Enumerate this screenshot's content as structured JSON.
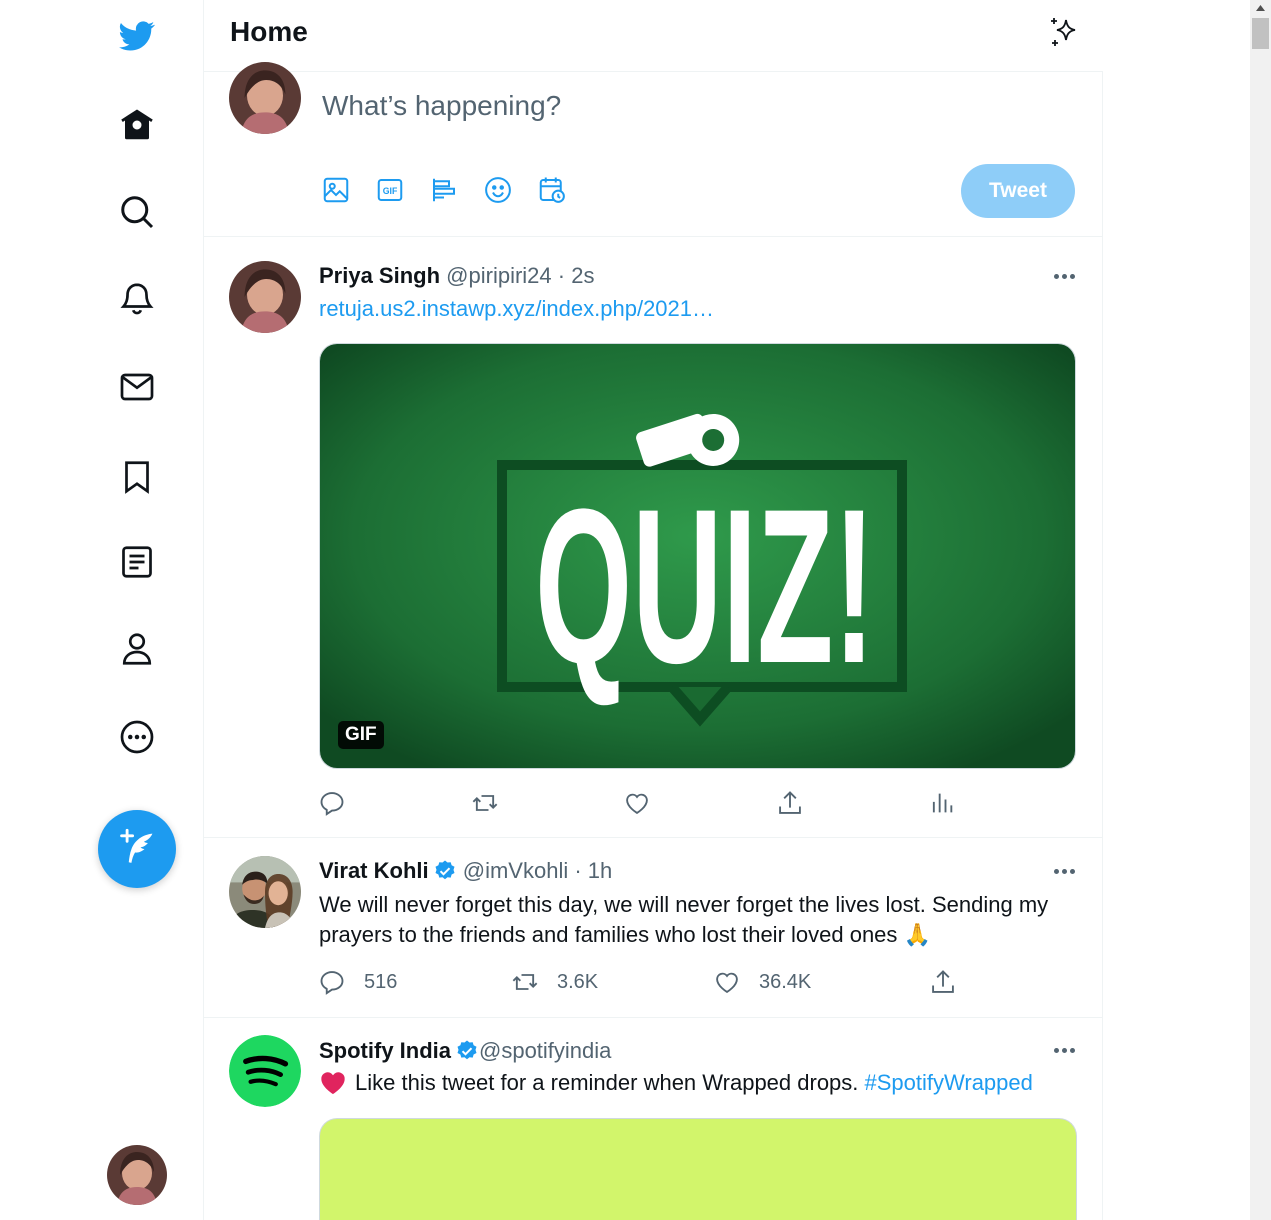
{
  "header": {
    "title": "Home"
  },
  "composer": {
    "placeholder": "What’s happening?",
    "tweet_label": "Tweet"
  },
  "tweets": [
    {
      "name": "Priya Singh",
      "handle": "@piripiri24",
      "sep": "·",
      "time": "2s",
      "link": "retuja.us2.instawp.xyz/index.php/2021…",
      "media_badge": "GIF",
      "media_text": "QUIZ!"
    },
    {
      "name": "Virat Kohli",
      "handle": "@imVkohli",
      "sep": "·",
      "time": "1h",
      "text": "We will never forget this day, we will never forget the lives lost. Sending my prayers to the friends and families who lost their loved ones 🙏",
      "replies": "516",
      "retweets": "3.6K",
      "likes": "36.4K"
    },
    {
      "name": "Spotify India",
      "handle": "@spotifyindia",
      "text_main": "Like this tweet for a reminder when Wrapped drops. ",
      "hashtag": "#SpotifyWrapped"
    }
  ],
  "colors": {
    "accent": "#1d9bf0",
    "tweet_button_disabled": "#8ecdf8",
    "quiz_green": "#1e7b3a",
    "spotify_green": "#1ed760",
    "spotify_media": "#d2f56b"
  }
}
